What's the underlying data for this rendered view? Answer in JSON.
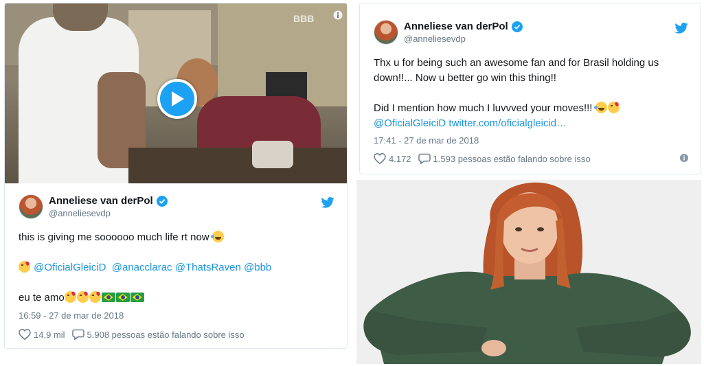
{
  "colors": {
    "accent": "#1da1f2",
    "link": "#1b95e0",
    "muted": "#657786",
    "text": "#14171a"
  },
  "left_tweet": {
    "video": {
      "watermark": "BBB",
      "play_icon": "play-icon",
      "info_icon": "info-icon"
    },
    "author_name": "Anneliese van derPol",
    "author_handle": "@anneliesevdp",
    "line1": "this is giving me soooooo much life rt now",
    "line1_emoji": "rofl",
    "mentions": [
      "@OficialGleiciD",
      "@anacclarac",
      "@ThatsRaven",
      "@bbb"
    ],
    "line3": "eu te amo",
    "timestamp": "16:59 - 27 de mar de 2018",
    "likes": "14,9 mil",
    "replies": "5.908 pessoas estão falando sobre isso"
  },
  "right_tweet": {
    "author_name": "Anneliese van derPol",
    "author_handle": "@anneliesevdp",
    "line1": "Thx u for being such an awesome fan and for Brasil holding us",
    "line2": "down!!... Now u better go win this thing!!",
    "line3": "Did I mention how much I luvvved your moves!!!",
    "mention": "@OficialGleiciD",
    "link": "twitter.com/oficialgleicid…",
    "timestamp": "17:41 - 27 de mar de 2018",
    "likes": "4.172",
    "replies": "1.593 pessoas estão falando sobre isso"
  }
}
